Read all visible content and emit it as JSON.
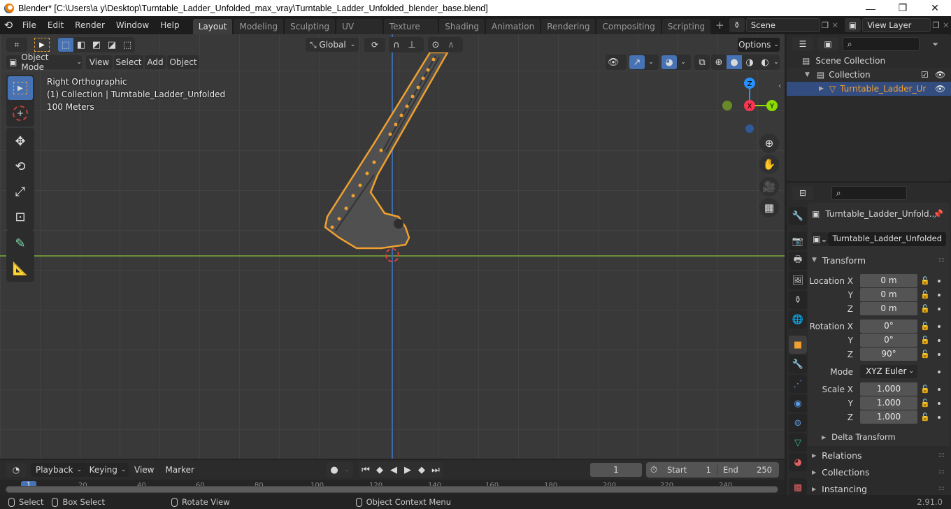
{
  "window": {
    "title": "Blender* [C:\\Users\\a y\\Desktop\\Turntable_Ladder_Unfolded_max_vray\\Turntable_Ladder_Unfolded_blender_base.blend]",
    "minimize": "—",
    "maximize": "❐",
    "close": "✕"
  },
  "menubar": {
    "items": [
      "File",
      "Edit",
      "Render",
      "Window",
      "Help"
    ],
    "workspaces": [
      "Layout",
      "Modeling",
      "Sculpting",
      "UV Editing",
      "Texture Paint",
      "Shading",
      "Animation",
      "Rendering",
      "Compositing",
      "Scripting"
    ],
    "active_workspace": "Layout",
    "add_workspace": "+",
    "scene": "Scene",
    "view_layer": "View Layer"
  },
  "viewport_header": {
    "transform_orientation": "Global",
    "options_label": "Options",
    "mode": "Object Mode",
    "menus": [
      "View",
      "Select",
      "Add",
      "Object"
    ]
  },
  "viewport": {
    "view_name": "Right Orthographic",
    "collection_info": "(1) Collection | Turntable_Ladder_Unfolded",
    "scale_info": "100 Meters",
    "gizmo": {
      "z": "Z",
      "x": "X",
      "y": "Y"
    },
    "colors": {
      "selection": "#f0a030",
      "x_axis": "#ff3352",
      "y_axis": "#8bdc00",
      "z_axis": "#2890ff",
      "active": "#4772b3"
    }
  },
  "outliner": {
    "scene_collection": "Scene Collection",
    "collection": "Collection",
    "object": "Turntable_Ladder_Ur"
  },
  "properties": {
    "object_name_header": "Turntable_Ladder_Unfold...",
    "object_name_field": "Turntable_Ladder_Unfolded",
    "transform_label": "Transform",
    "location": {
      "label_x": "Location X",
      "label_y": "Y",
      "label_z": "Z",
      "x": "0 m",
      "y": "0 m",
      "z": "0 m"
    },
    "rotation": {
      "label_x": "Rotation X",
      "label_y": "Y",
      "label_z": "Z",
      "x": "0°",
      "y": "0°",
      "z": "90°"
    },
    "mode_label": "Mode",
    "mode_value": "XYZ Euler",
    "scale": {
      "label_x": "Scale X",
      "label_y": "Y",
      "label_z": "Z",
      "x": "1.000",
      "y": "1.000",
      "z": "1.000"
    },
    "delta_transform": "Delta Transform",
    "panels": [
      "Relations",
      "Collections",
      "Instancing"
    ]
  },
  "timeline": {
    "menus": [
      "Playback",
      "Keying",
      "View",
      "Marker"
    ],
    "current_frame": "1",
    "start_label": "Start",
    "start_value": "1",
    "end_label": "End",
    "end_value": "250",
    "ruler_ticks": [
      "20",
      "40",
      "60",
      "80",
      "100",
      "120",
      "140",
      "160",
      "180",
      "200",
      "220",
      "240"
    ],
    "playhead": "1"
  },
  "statusbar": {
    "select": "Select",
    "box_select": "Box Select",
    "rotate_view": "Rotate View",
    "context_menu": "Object Context Menu",
    "version": "2.91.0"
  }
}
